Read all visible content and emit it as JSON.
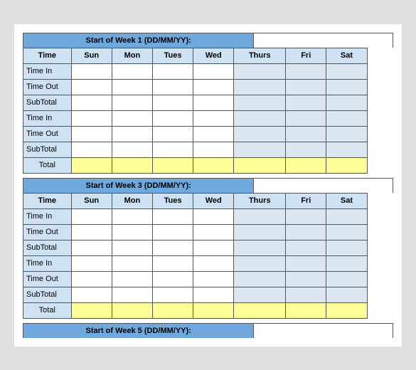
{
  "weeks": [
    {
      "header": "Start of Week 1 (DD/MM/YY):",
      "rows": [
        {
          "label": "Time",
          "isHeader": true
        },
        {
          "label": "Time In"
        },
        {
          "label": "Time Out"
        },
        {
          "label": "SubTotal"
        },
        {
          "label": "Time In"
        },
        {
          "label": "Time Out"
        },
        {
          "label": "SubTotal"
        },
        {
          "label": "Total",
          "isTotal": true
        }
      ]
    },
    {
      "header": "Start of Week 3 (DD/MM/YY):",
      "rows": [
        {
          "label": "Time",
          "isHeader": true
        },
        {
          "label": "Time In"
        },
        {
          "label": "Time Out"
        },
        {
          "label": "SubTotal"
        },
        {
          "label": "Time In"
        },
        {
          "label": "Time Out"
        },
        {
          "label": "SubTotal"
        },
        {
          "label": "Total",
          "isTotal": true
        }
      ]
    }
  ],
  "week5_header": "Start of Week 5 (DD/MM/YY):",
  "columns": {
    "days": [
      "Sun",
      "Mon",
      "Tues",
      "Wed"
    ],
    "thurs_fri_sat": [
      "Thurs",
      "Fri",
      "Sat"
    ]
  }
}
